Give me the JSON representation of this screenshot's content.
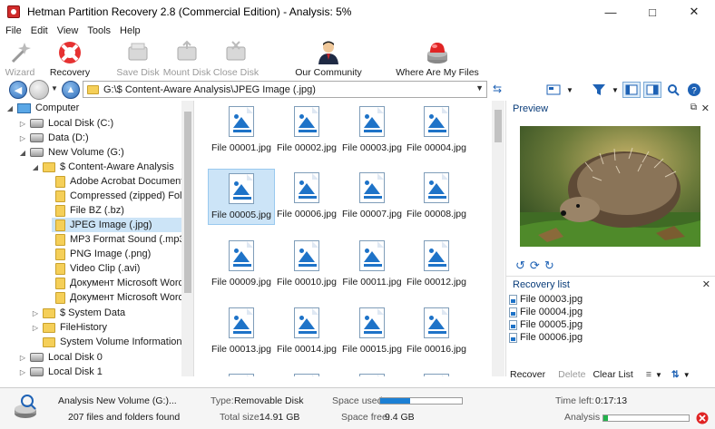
{
  "window": {
    "title": "Hetman Partition Recovery 2.8 (Commercial Edition) - Analysis: 5%"
  },
  "menu": [
    "File",
    "Edit",
    "View",
    "Tools",
    "Help"
  ],
  "toolbar": {
    "wizard": "Wizard",
    "recovery": "Recovery",
    "save_disk": "Save Disk",
    "mount_disk": "Mount Disk",
    "close_disk": "Close Disk",
    "community": "Our Community",
    "where_files": "Where Are My Files"
  },
  "address": {
    "path": "G:\\$ Content-Aware Analysis\\JPEG Image (.jpg)"
  },
  "tree": [
    {
      "label": "Computer"
    },
    {
      "label": "Local Disk (C:)"
    },
    {
      "label": "Data (D:)"
    },
    {
      "label": "New Volume (G:)"
    },
    {
      "label": "$ Content-Aware Analysis"
    },
    {
      "label": "Adobe Acrobat Document (."
    },
    {
      "label": "Compressed (zipped) Folder"
    },
    {
      "label": "File BZ (.bz)"
    },
    {
      "label": "JPEG Image (.jpg)"
    },
    {
      "label": "MP3 Format Sound (.mp3)"
    },
    {
      "label": "PNG Image (.png)"
    },
    {
      "label": "Video Clip (.avi)"
    },
    {
      "label": "Документ Microsoft Word (."
    },
    {
      "label": "Документ Microsoft Word 9"
    },
    {
      "label": "$ System Data"
    },
    {
      "label": "FileHistory"
    },
    {
      "label": "System Volume Information"
    },
    {
      "label": "Local Disk 0"
    },
    {
      "label": "Local Disk 1"
    }
  ],
  "files": [
    "File 00001.jpg",
    "File 00002.jpg",
    "File 00003.jpg",
    "File 00004.jpg",
    "File 00005.jpg",
    "File 00006.jpg",
    "File 00007.jpg",
    "File 00008.jpg",
    "File 00009.jpg",
    "File 00010.jpg",
    "File 00011.jpg",
    "File 00012.jpg",
    "File 00013.jpg",
    "File 00014.jpg",
    "File 00015.jpg",
    "File 00016.jpg"
  ],
  "selected_file_index": 4,
  "preview": {
    "title": "Preview"
  },
  "recovery_list": {
    "title": "Recovery list",
    "items": [
      "File 00003.jpg",
      "File 00004.jpg",
      "File 00005.jpg",
      "File 00006.jpg"
    ],
    "recover": "Recover",
    "delete": "Delete",
    "clear": "Clear List"
  },
  "status": {
    "name": "Analysis New Volume (G:)...",
    "count": "207 files and folders found",
    "type_label": "Type:",
    "type_value": "Removable Disk",
    "total_label": "Total size:",
    "total_value": "14.91 GB",
    "used_label": "Space used:",
    "used_fraction": 0.37,
    "free_label": "Space free:",
    "free_value": "9.4 GB",
    "time_label": "Time left:",
    "time_value": "0:17:13",
    "analysis_label": "Analysis",
    "analysis_fraction": 0.05
  },
  "colors": {
    "accent": "#1e73c8",
    "selection": "#cce4f7",
    "progress": "#22b24c"
  }
}
